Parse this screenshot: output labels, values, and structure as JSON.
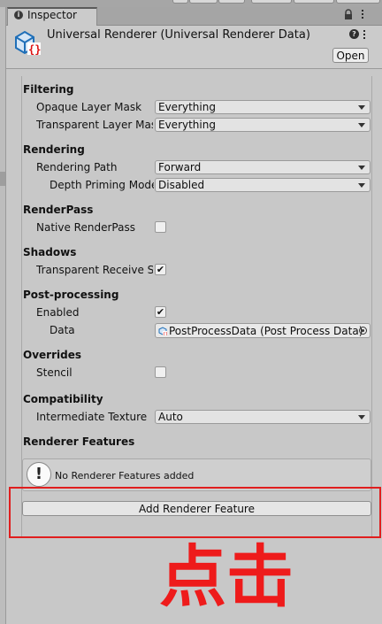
{
  "tab": {
    "label": "Inspector"
  },
  "header": {
    "title": "Universal Renderer (Universal Renderer Data)",
    "open_label": "Open"
  },
  "sections": {
    "filtering": {
      "title": "Filtering",
      "opaque_label": "Opaque Layer Mask",
      "opaque_value": "Everything",
      "transparent_label": "Transparent Layer Mask",
      "transparent_value": "Everything"
    },
    "rendering": {
      "title": "Rendering",
      "path_label": "Rendering Path",
      "path_value": "Forward",
      "depth_label": "Depth Priming Mode",
      "depth_value": "Disabled"
    },
    "renderpass": {
      "title": "RenderPass",
      "native_label": "Native RenderPass",
      "native_checked": false
    },
    "shadows": {
      "title": "Shadows",
      "receive_label": "Transparent Receive Shadows",
      "receive_checked": true
    },
    "postprocessing": {
      "title": "Post-processing",
      "enabled_label": "Enabled",
      "enabled_checked": true,
      "data_label": "Data",
      "data_value": "PostProcessData (Post Process Data)"
    },
    "overrides": {
      "title": "Overrides",
      "stencil_label": "Stencil",
      "stencil_checked": false
    },
    "compatibility": {
      "title": "Compatibility",
      "intermediate_label": "Intermediate Texture",
      "intermediate_value": "Auto"
    },
    "renderer_features": {
      "title": "Renderer Features",
      "empty_message": "No Renderer Features added",
      "add_button": "Add Renderer Feature"
    }
  },
  "annotation": {
    "text": "点击",
    "color": "#ee1b1b"
  },
  "icons": [
    "info-icon",
    "lock-icon",
    "kebab-icon",
    "asset-icon",
    "help-icon",
    "dropdown-arrow-icon",
    "check-icon",
    "object-icon",
    "object-picker-icon",
    "warning-icon"
  ]
}
